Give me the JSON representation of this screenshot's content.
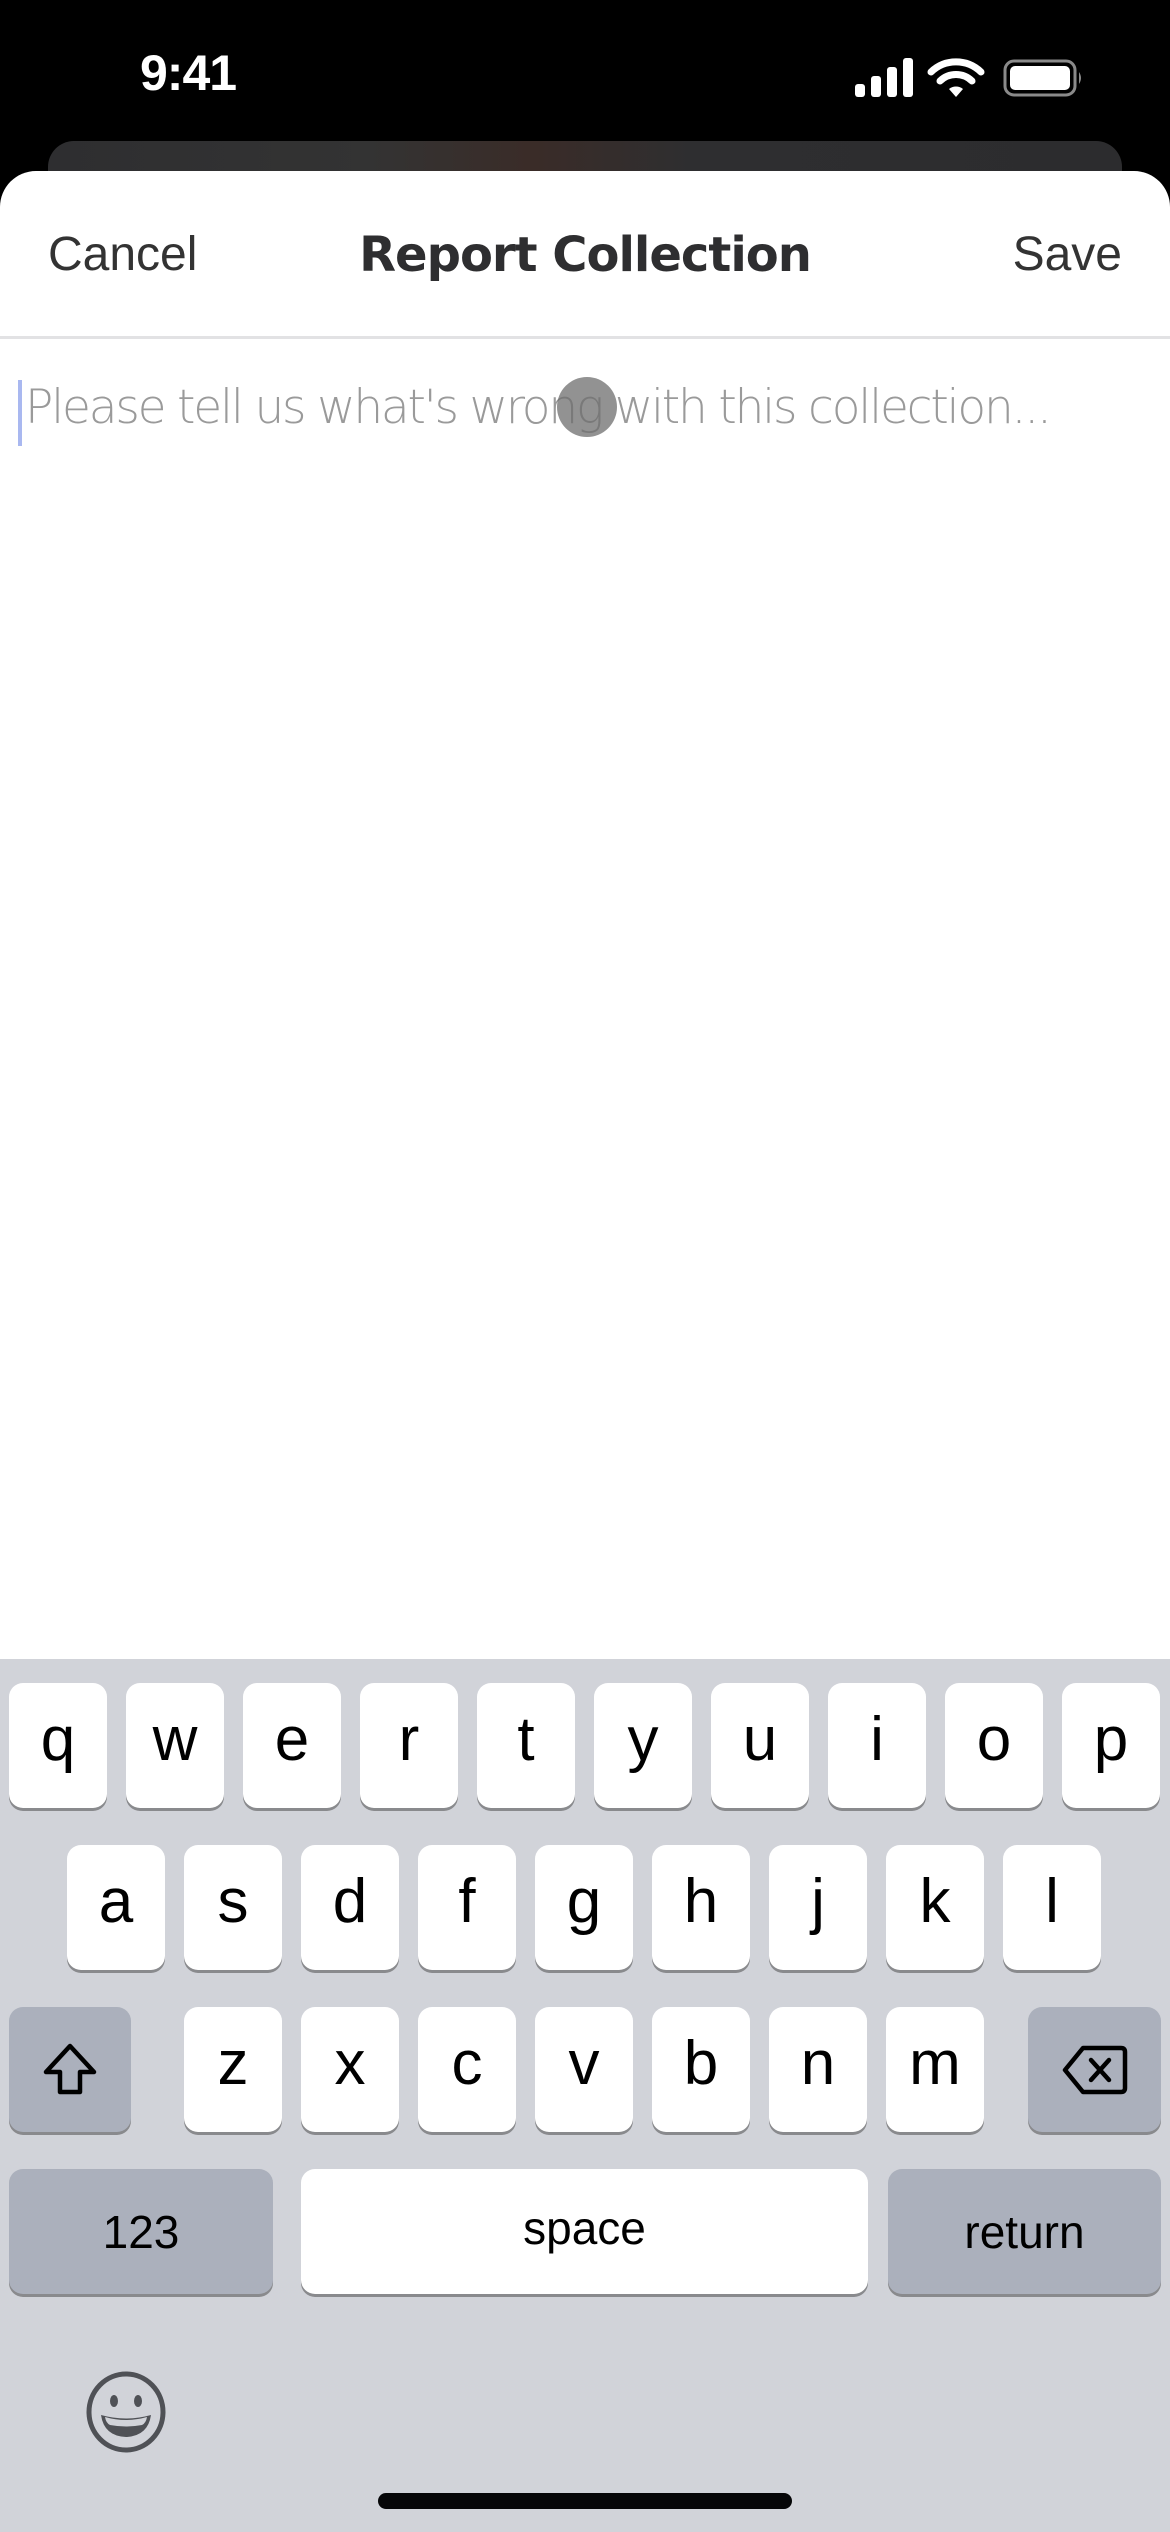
{
  "status_bar": {
    "time": "9:41",
    "icons": [
      "cellular-signal-icon",
      "wifi-icon",
      "battery-icon"
    ]
  },
  "sheet": {
    "nav": {
      "cancel_label": "Cancel",
      "title": "Report Collection",
      "save_label": "Save"
    },
    "report_input": {
      "value": "",
      "placeholder": "Please tell us what's wrong with this collection..."
    }
  },
  "keyboard": {
    "row1": [
      "q",
      "w",
      "e",
      "r",
      "t",
      "y",
      "u",
      "i",
      "o",
      "p"
    ],
    "row2": [
      "a",
      "s",
      "d",
      "f",
      "g",
      "h",
      "j",
      "k",
      "l"
    ],
    "row3": [
      "z",
      "x",
      "c",
      "v",
      "b",
      "n",
      "m"
    ],
    "shift_icon": "shift-icon",
    "delete_icon": "delete-icon",
    "numbers_label": "123",
    "space_label": "space",
    "return_label": "return",
    "emoji_icon": "emoji-icon"
  },
  "colors": {
    "keyboard_bg": "#d1d3d9",
    "key_bg": "#ffffff",
    "function_key_bg": "#abb0bc",
    "placeholder_text": "#9a9a9a",
    "caret": "#a9b8f0"
  }
}
